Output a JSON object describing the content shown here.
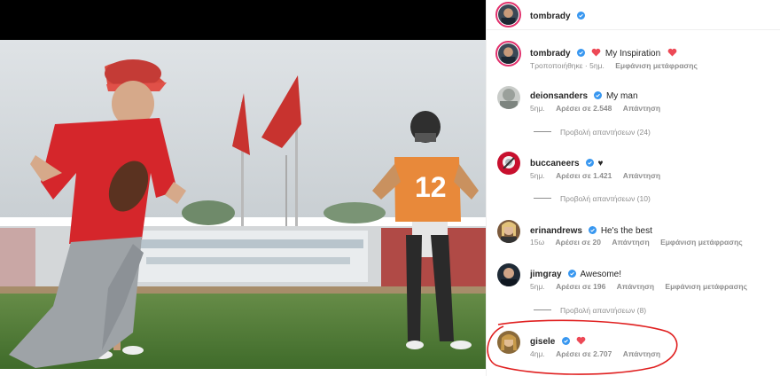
{
  "post": {
    "author": "tombrady",
    "caption": "My Inspiration",
    "caption_meta": [
      "Τροποποιήθηκε · 5ημ.",
      "Εμφάνιση μετάφρασης"
    ]
  },
  "colors": {
    "verified": "#3897f0",
    "heart": "#ed4956",
    "annotation": "#e02020",
    "meta": "#8e8e8e"
  },
  "comments": [
    {
      "user": "deionsanders",
      "text": "My man",
      "time": "5ημ.",
      "likes": "Αρέσει σε 2.548",
      "reply": "Απάντηση",
      "replies": "Προβολή απαντήσεων (24)"
    },
    {
      "user": "buccaneers",
      "text": "♥",
      "time": "5ημ.",
      "likes": "Αρέσει σε 1.421",
      "reply": "Απάντηση",
      "replies": "Προβολή απαντήσεων (10)"
    },
    {
      "user": "erinandrews",
      "text": "He's the best",
      "time": "15ω",
      "likes": "Αρέσει σε 20",
      "reply": "Απάντηση",
      "translate": "Εμφάνιση μετάφρασης"
    },
    {
      "user": "jimgray",
      "text": "Awesome!",
      "time": "5ημ.",
      "likes": "Αρέσει σε 196",
      "reply": "Απάντηση",
      "translate": "Εμφάνιση μετάφρασης",
      "replies": "Προβολή απαντήσεων (8)"
    },
    {
      "user": "gisele",
      "text": "",
      "time": "4ημ.",
      "likes": "Αρέσει σε 2.707",
      "reply": "Απάντηση"
    }
  ],
  "photo": {
    "jersey_number": "12"
  }
}
